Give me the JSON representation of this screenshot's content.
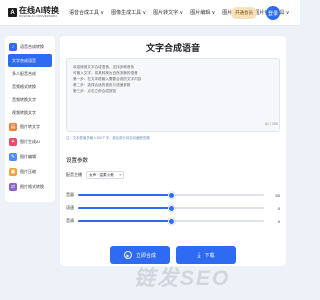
{
  "header": {
    "logo_mark": "A",
    "logo_title": "在线AI转换",
    "logo_sub": "ONLINE AI CONVERSION",
    "nav": [
      "语音合成工具 ∨",
      "图像生成工具 ∨",
      "图片转文字 ∨",
      "图片编辑 ∨",
      "图片压缩 ∨",
      "图片修改工具 ∨"
    ],
    "vip_label": "开通会员",
    "avatar_label": "登录"
  },
  "sidebar": {
    "group_label": "语音合成转换",
    "sub_items": [
      {
        "label": "文字合成语音",
        "active": true
      },
      {
        "label": "多人配音合成",
        "active": false
      },
      {
        "label": "音频格式转换",
        "active": false
      },
      {
        "label": "音频转换文字",
        "active": false
      },
      {
        "label": "视频转换文字",
        "active": false
      }
    ],
    "items": [
      {
        "label": "图片转文字",
        "icon": "image-text-icon",
        "color": "#f07d3a"
      },
      {
        "label": "图片生成AI",
        "icon": "ai-image-icon",
        "color": "#e94b6b"
      },
      {
        "label": "图片编辑",
        "icon": "edit-icon",
        "color": "#4b8df5"
      },
      {
        "label": "图片压缩",
        "icon": "compress-icon",
        "color": "#f0a23a"
      },
      {
        "label": "图片格式转换",
        "icon": "format-icon",
        "color": "#8a63d2"
      }
    ]
  },
  "main": {
    "title": "文字合成语音",
    "text_lines": [
      "欢迎使用文字合成语音，支持多种音色",
      "可输入文字，将其转换为自然流畅的语音",
      "第一步：在文本框输入需要合成的文字内容",
      "第二步：选择合适的音色与语速参数",
      "第三步：点击立即合成按钮"
    ],
    "counter": "61 / 300",
    "hint": "注：文本框最多输入300个字，超出部分将自动截断忽略",
    "section_title": "设置参数",
    "voice_label": "配音主播",
    "voice_value": "女声 · 温柔小美",
    "sliders": [
      {
        "label": "音量",
        "value": "50",
        "level": 0.5
      },
      {
        "label": "语速",
        "value": "0",
        "level": 0.5
      },
      {
        "label": "音调",
        "value": "0",
        "level": 0.5
      }
    ],
    "synth_button": "立即合成",
    "download_button": "下载"
  },
  "watermark": "链发SEO",
  "colors": {
    "accent": "#2f6bf2",
    "vip_bg": "#f7e1b8"
  }
}
